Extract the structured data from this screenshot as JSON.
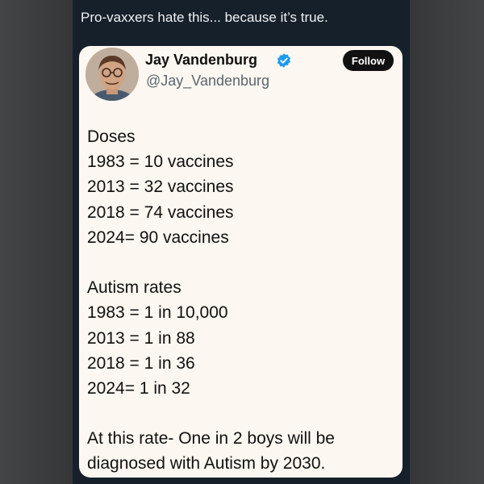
{
  "caption": "Pro-vaxxers hate this... because it’s true.",
  "tweet": {
    "author_name": "Jay Vandenburg",
    "author_handle": "@Jay_Vandenburg",
    "follow_label": "Follow",
    "doses_heading": "Doses",
    "doses_lines": [
      "1983 = 10 vaccines",
      "2013 = 32 vaccines",
      "2018 = 74 vaccines",
      "2024= 90 vaccines"
    ],
    "autism_heading": "Autism rates",
    "autism_lines": [
      "1983 = 1 in 10,000",
      "2013 = 1 in 88",
      "2018 = 1 in 36",
      "2024= 1 in 32"
    ],
    "conclusion_line1": "At this rate-  One in 2 boys will be",
    "conclusion_line2": "diagnosed with  Autism by 2030."
  },
  "colors": {
    "card_background": "#fcf7f0",
    "app_background": "#15202b",
    "verified_badge": "#1d9bf0"
  }
}
